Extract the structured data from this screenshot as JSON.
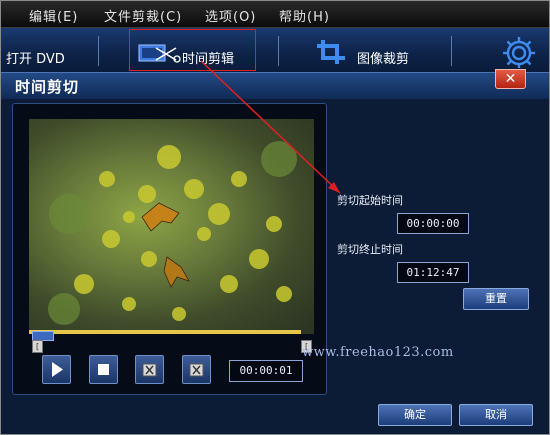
{
  "menubar": {
    "items": [
      "编辑(E)",
      "文件剪裁(C)",
      "选项(O)",
      "帮助(H)"
    ]
  },
  "toolbar": {
    "open_dvd": "打开 DVD",
    "time_cut": "时间剪辑",
    "image_crop": "图像裁剪",
    "icons": [
      "scissors-film-icon",
      "crop-icon",
      "gear-icon"
    ]
  },
  "dialog": {
    "title": "时间剪切",
    "close": "✕"
  },
  "player": {
    "current_time": "00:00:01",
    "marker_label": "[",
    "buttons": [
      "play-icon",
      "stop-icon",
      "mark-in-icon",
      "mark-out-icon"
    ]
  },
  "cut": {
    "start_label": "剪切起始时间",
    "start_time": "00:00:00",
    "end_label": "剪切终止时间",
    "end_time": "01:12:47",
    "reset": "重置"
  },
  "footer": {
    "ok": "确定",
    "cancel": "取消"
  },
  "watermark": "www.freehao123.com",
  "colors": {
    "accent": "#e02020",
    "panel": "#0c1b36",
    "toolbar": "#0d2247",
    "seek_bar": "#e6c64a"
  }
}
